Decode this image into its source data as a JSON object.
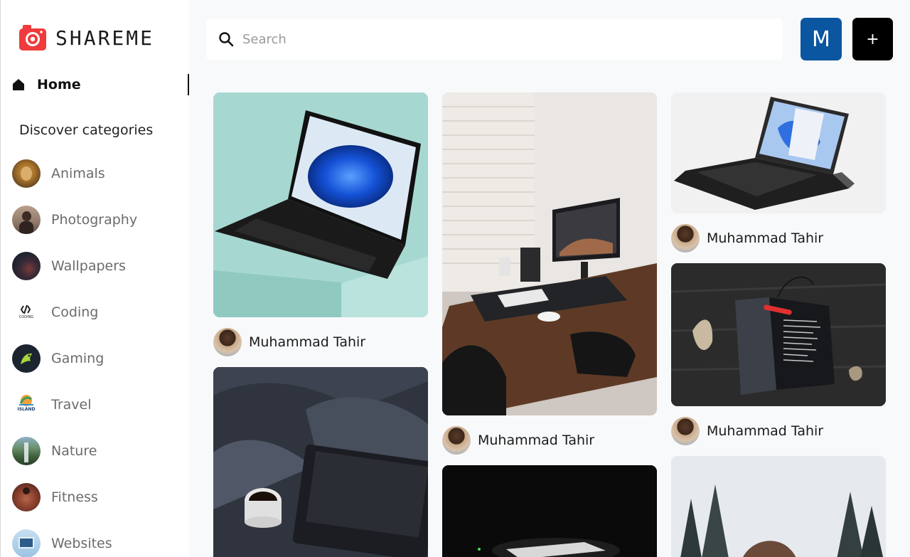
{
  "brand": {
    "name": "SHAREME",
    "accent": "#ef3b3b"
  },
  "nav": {
    "home_label": "Home"
  },
  "sidebar": {
    "discover_title": "Discover categories",
    "categories": [
      {
        "label": "Animals",
        "icon": "lion-photo"
      },
      {
        "label": "Photography",
        "icon": "portrait-photo"
      },
      {
        "label": "Wallpapers",
        "icon": "abstract-photo"
      },
      {
        "label": "Coding",
        "icon": "coding-logo"
      },
      {
        "label": "Gaming",
        "icon": "gaming-logo"
      },
      {
        "label": "Travel",
        "icon": "island-logo"
      },
      {
        "label": "Nature",
        "icon": "waterfall-photo"
      },
      {
        "label": "Fitness",
        "icon": "athlete-photo"
      },
      {
        "label": "Websites",
        "icon": "website-photo"
      }
    ],
    "coding_logo_text": "CODING",
    "travel_logo_text": "ISLAND"
  },
  "search": {
    "placeholder": "Search",
    "value": ""
  },
  "user": {
    "initial": "M",
    "color": "#0a56a0"
  },
  "add_button": {
    "label": "+"
  },
  "pins": [
    {
      "author": "Muhammad Tahir",
      "image": "laptop on mint pedestal"
    },
    {
      "author": "Muhammad Tahir",
      "image": "desk setup with monitor"
    },
    {
      "author": "Muhammad Tahir",
      "image": "surface tablet with keyboard"
    },
    {
      "author": "Muhammad Tahir",
      "image": "notebook on wooden table"
    },
    {
      "author": "",
      "image": "laptop with coffee on bed"
    },
    {
      "author": "",
      "image": "dark room with light"
    },
    {
      "author": "",
      "image": "snowy trees portrait"
    }
  ]
}
